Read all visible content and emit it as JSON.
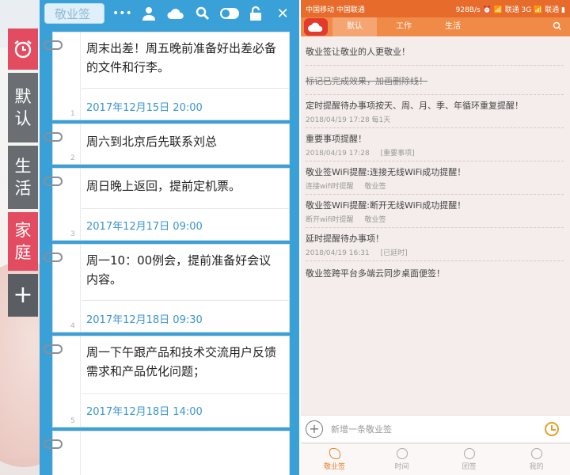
{
  "left": {
    "toolbar": {
      "search_placeholder": "敬业签",
      "more": "•••",
      "close": "✕"
    },
    "sidebar": [
      {
        "label": ""
      },
      {
        "label": "默\n认"
      },
      {
        "label": "生\n活"
      },
      {
        "label": "家\n庭"
      },
      {
        "label": "+"
      }
    ],
    "notes": [
      {
        "text": "周末出差！周五晚前准备好出差必备的文件和行李。",
        "date": "2017年12月15日 20:00",
        "num": "1"
      },
      {
        "text": "周六到北京后先联系刘总",
        "date": "",
        "num": "2"
      },
      {
        "text": "周日晚上返回，提前定机票。",
        "date": "2017年12月17日 09:00",
        "num": "3"
      },
      {
        "text": "周一10：00例会，提前准备好会议内容。",
        "date": "2017年12月18日 09:30",
        "num": "4"
      },
      {
        "text": "周一下午跟产品和技术交流用户反馈需求和产品优化问题；",
        "date": "2017年12月18日 14:00",
        "num": "5"
      }
    ]
  },
  "right": {
    "status_left": "中国移动 中国联通",
    "status_right": "928B/s ⏰ 📶 联通 3G 📶 联通 ▮",
    "tabs": [
      "默认",
      "工作",
      "生活"
    ],
    "items": [
      {
        "text": "敬业签让敬业的人更敬业！",
        "meta": [],
        "strike": false
      },
      {
        "text": "标记已完成效果，加画删除线！",
        "meta": [],
        "strike": true
      },
      {
        "text": "定时提醒待办事项按天、周、月、季、年循环重复提醒！",
        "meta": [
          "2018/04/19 17:28 每1天"
        ],
        "strike": false
      },
      {
        "text": "重要事项提醒！",
        "meta": [
          "2018/04/19 17:28",
          "[重要事项]"
        ],
        "strike": false
      },
      {
        "text": "敬业签WiFi提醒:连接无线WiFi成功提醒！",
        "meta": [
          "连接wifi时提醒",
          "敬业签"
        ],
        "strike": false
      },
      {
        "text": "敬业签WiFi提醒:断开无线WiFi成功提醒！",
        "meta": [
          "断开wifi时提醒",
          "敬业签"
        ],
        "strike": false
      },
      {
        "text": "延时提醒待办事项！",
        "meta": [
          "2018/04/19 16:31",
          "[已延时]"
        ],
        "strike": false
      },
      {
        "text": "敬业签跨平台多端云同步桌面便签！",
        "meta": [],
        "strike": false
      }
    ],
    "new_placeholder": "新增一条敬业签",
    "bottom_nav": [
      "敬业签",
      "时间",
      "团签",
      "我的"
    ]
  }
}
